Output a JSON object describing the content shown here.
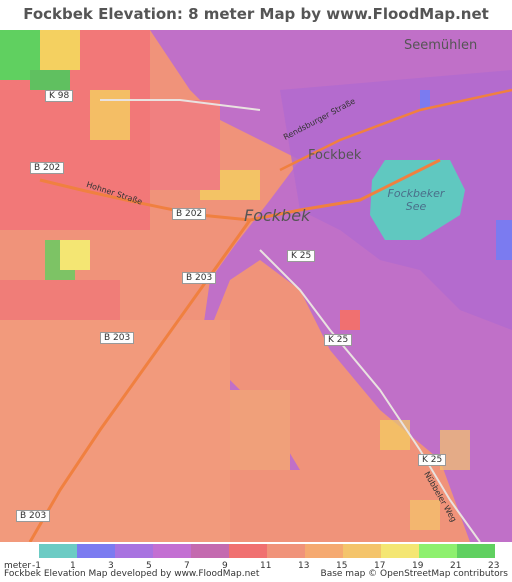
{
  "title": "Fockbek Elevation: 8 meter Map by www.FloodMap.net (beta)",
  "map": {
    "places": {
      "fockbek_main": "Fockbek",
      "fockbek_small": "Fockbek",
      "seemuehlen": "Seemühlen"
    },
    "lake": {
      "line1": "Fockbeker",
      "line2": "See"
    },
    "roads": {
      "k98": "K 98",
      "b202_west": "B 202",
      "b202_center": "B 202",
      "b203_north": "B 203",
      "b203_mid": "B 203",
      "b203_south": "B 203",
      "k25_a": "K 25",
      "k25_b": "K 25",
      "k25_c": "K 25"
    },
    "streets": {
      "rendsburger": "Rendsburger Straße",
      "hohner": "Hohner Straße",
      "nuebbeler": "Nübbeler Weg"
    },
    "colors": {
      "low_elevation": "#c070c8",
      "mid_elevation": "#f0937a",
      "high_elevation": "#f4d060",
      "highest_elevation": "#60d060",
      "water": "#60c8c0",
      "road": "#f08040"
    }
  },
  "legend": {
    "unit": "meter",
    "ticks": [
      "-1",
      "1",
      "3",
      "5",
      "7",
      "9",
      "11",
      "13",
      "15",
      "17",
      "19",
      "21",
      "23"
    ],
    "colors": [
      "#6ccbc4",
      "#7b7bf0",
      "#a873e0",
      "#c36fd2",
      "#c46aaf",
      "#f07070",
      "#f0937a",
      "#f5a970",
      "#f4c46b",
      "#f4e673",
      "#8ef06e",
      "#60d060"
    ]
  },
  "footer": {
    "left": "Fockbek Elevation Map developed by www.FloodMap.net",
    "right": "Base map © OpenStreetMap contributors"
  }
}
